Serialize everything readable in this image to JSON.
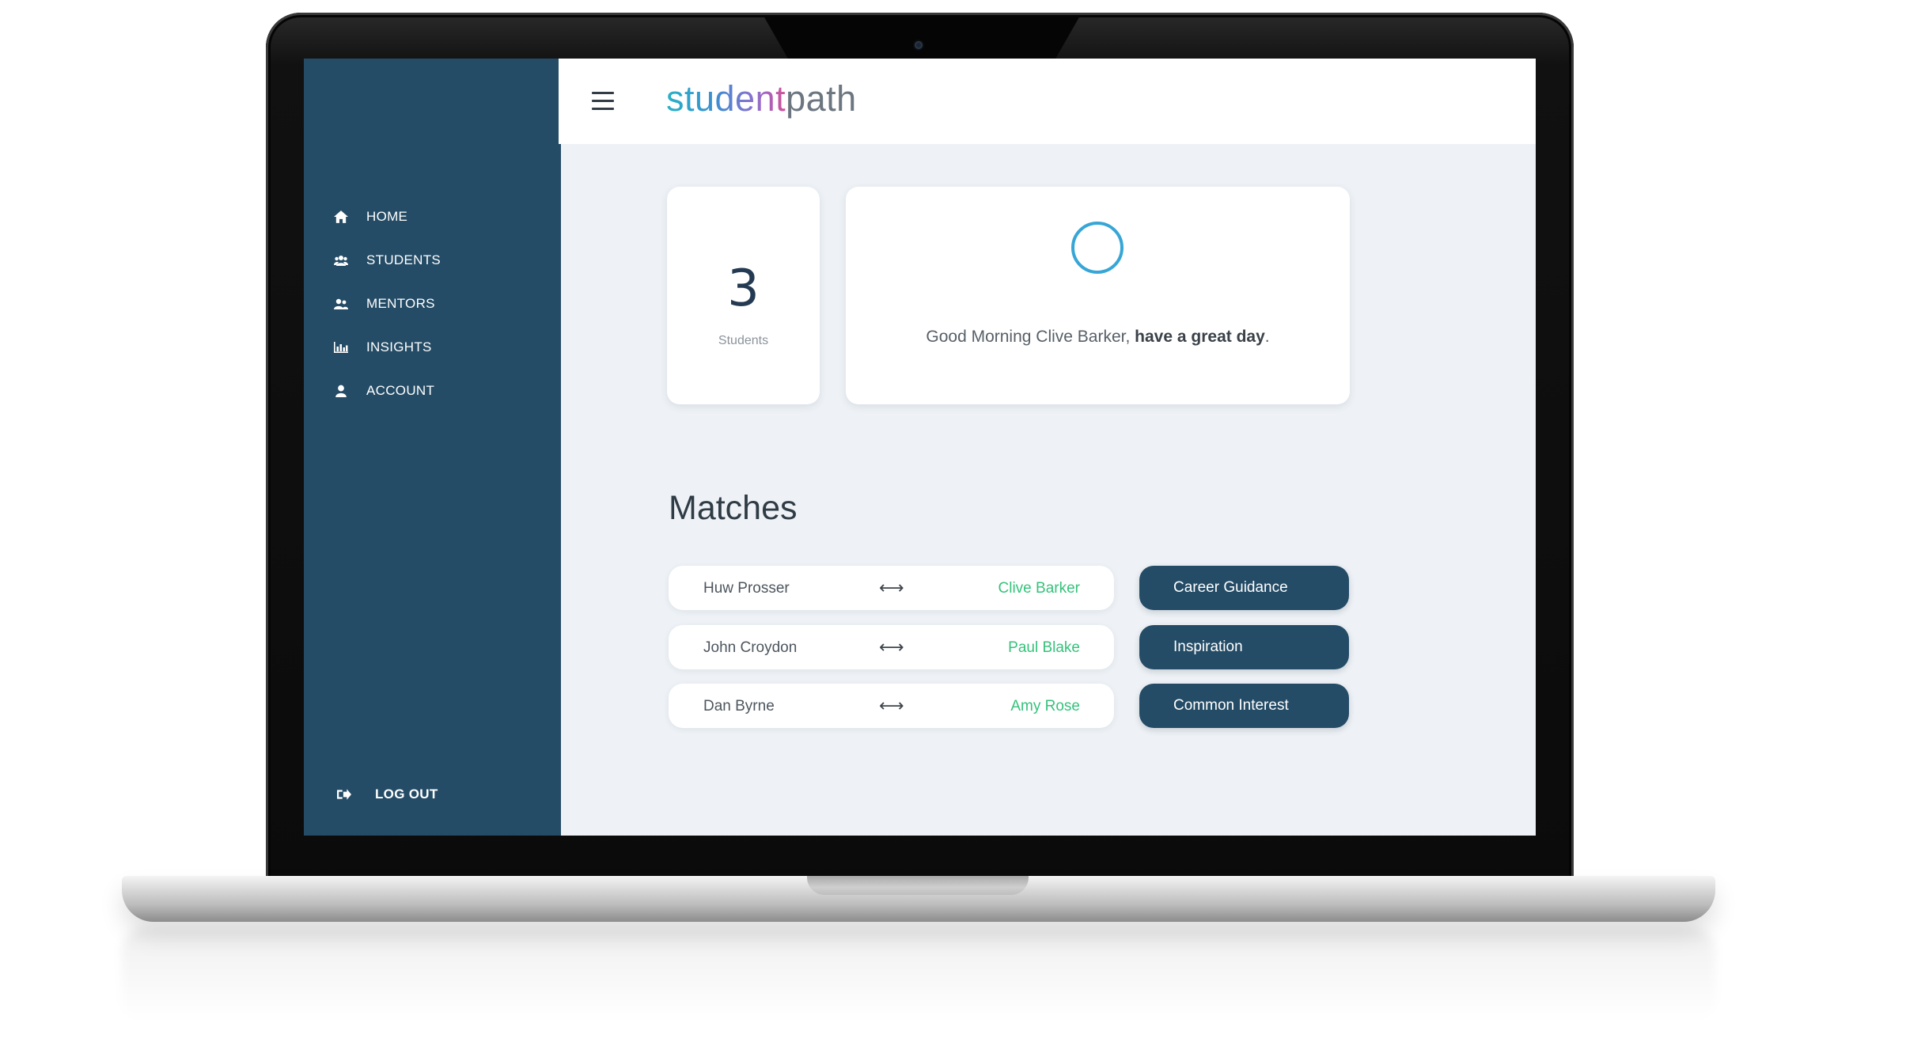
{
  "app": {
    "brand_part1": "student",
    "brand_part2": "path"
  },
  "sidebar": {
    "items": [
      {
        "label": "HOME",
        "icon": "home-icon"
      },
      {
        "label": "STUDENTS",
        "icon": "users-icon"
      },
      {
        "label": "MENTORS",
        "icon": "mentors-icon"
      },
      {
        "label": "INSIGHTS",
        "icon": "bar-chart-icon"
      },
      {
        "label": "ACCOUNT",
        "icon": "user-icon"
      }
    ],
    "logout_label": "LOG OUT"
  },
  "stats": {
    "value": "3",
    "label": "Students"
  },
  "greeting": {
    "prefix": "Good Morning Clive Barker, ",
    "emphasis": "have a great day",
    "suffix": "."
  },
  "matches": {
    "title": "Matches",
    "rows": [
      {
        "student": "Huw Prosser",
        "mentor": "Clive Barker",
        "reason": "Career Guidance"
      },
      {
        "student": "John Croydon",
        "mentor": "Paul Blake",
        "reason": "Inspiration"
      },
      {
        "student": "Dan Byrne",
        "mentor": "Amy Rose",
        "reason": "Common Interest"
      }
    ],
    "arrow": "⟷"
  },
  "colors": {
    "sidebar": "#244c66",
    "background": "#eef2f6",
    "mentor_text": "#35c27b",
    "ring": "#37a6d6"
  }
}
